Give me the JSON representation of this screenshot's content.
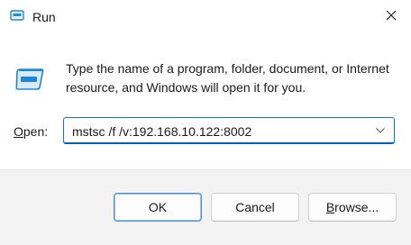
{
  "window": {
    "title": "Run",
    "title_icon": "run-dialog-icon",
    "close_icon": "close-icon"
  },
  "content": {
    "icon": "run-dialog-icon",
    "description": "Type the name of a program, folder, document, or Internet resource, and Windows will open it for you."
  },
  "open_field": {
    "label_prefix": "",
    "label_underlined": "O",
    "label_rest": "pen:",
    "value": "mstsc /f /v:192.168.10.122:8002",
    "dropdown_icon": "chevron-down-icon"
  },
  "buttons": {
    "ok": "OK",
    "cancel": "Cancel",
    "browse_underlined": "B",
    "browse_rest": "rowse..."
  },
  "colors": {
    "accent": "#005fb8",
    "footer_bg": "#f3f3f3",
    "icon_blue": "#1e88d8"
  }
}
